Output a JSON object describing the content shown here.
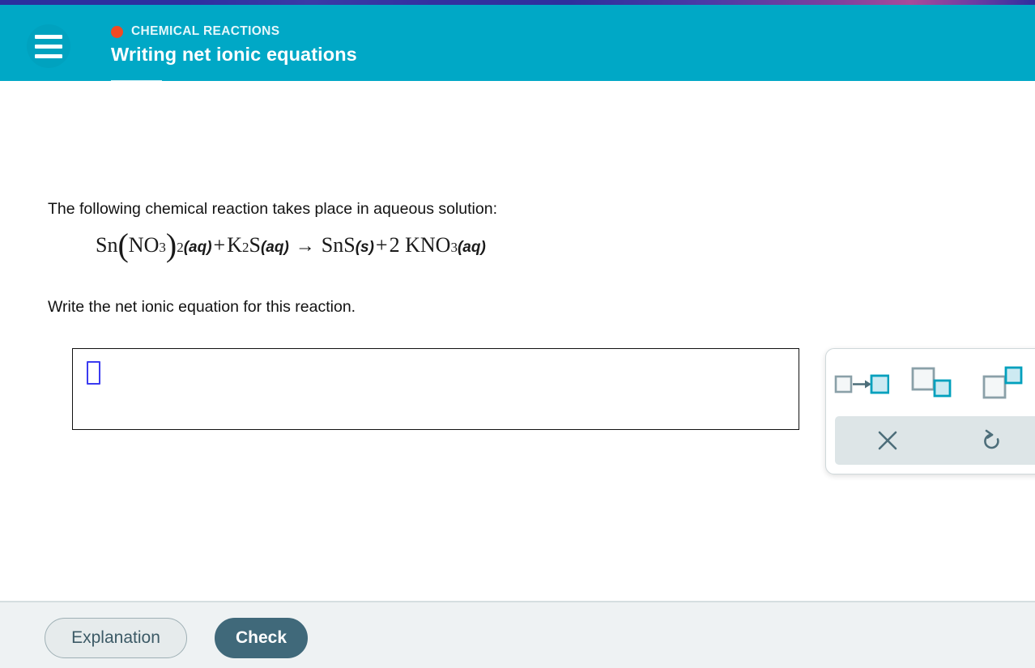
{
  "header": {
    "eyebrow": "CHEMICAL REACTIONS",
    "title": "Writing net ionic equations",
    "dot_color": "#f04a23",
    "bar_color": "#00a8c6",
    "menu_icon": "hamburger-icon"
  },
  "collapse_tab": {
    "icon": "chevron-down-icon",
    "color": "#00a8c6",
    "background": "#c9edf4"
  },
  "content": {
    "prompt_1": "The following chemical reaction takes place in aqueous solution:",
    "prompt_2": "Write the net ionic equation for this reaction.",
    "equation": {
      "plain": "Sn(NO3)2(aq) + K2S(aq) → SnS(s) + 2 KNO3(aq)",
      "parts": {
        "r1_sym": "Sn",
        "r1_paren_open": "(",
        "r1_group": "NO",
        "r1_group_sub": "3",
        "r1_paren_close": ")",
        "r1_paren_sub": "2",
        "r1_phase": "(aq)",
        "plus_1": "+",
        "r2_sym_a": "K",
        "r2_sub_a": "2",
        "r2_sym_b": "S",
        "r2_phase": "(aq)",
        "arrow": "→",
        "p1_sym": "SnS",
        "p1_phase": "(s)",
        "plus_2": "+",
        "p2_coeff": "2",
        "p2_sym": "KNO",
        "p2_sub": "3",
        "p2_phase": "(aq)"
      }
    }
  },
  "answer": {
    "value": "",
    "cursor_slot_color": "#3b3bf0"
  },
  "palette": {
    "templates": [
      {
        "name": "arrow-template",
        "label": "□→□"
      },
      {
        "name": "subscript-template",
        "label": "□▫"
      },
      {
        "name": "superscript-template",
        "label": "□^▫"
      }
    ],
    "actions": [
      {
        "name": "clear-button",
        "icon": "close-x-icon",
        "glyph": "✕"
      },
      {
        "name": "undo-button",
        "icon": "undo-arrow-icon",
        "glyph": "↺"
      }
    ]
  },
  "footer": {
    "explanation_label": "Explanation",
    "check_label": "Check",
    "check_color": "#40697a"
  }
}
